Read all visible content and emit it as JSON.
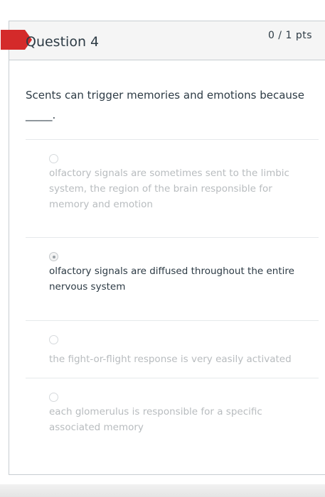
{
  "question": {
    "title": "Question 4",
    "points": "0 / 1 pts",
    "text": "Scents can trigger memories and emotions because _____.",
    "flag_color": "#d42a2a"
  },
  "answers": [
    {
      "text": "olfactory signals are sometimes sent to the limbic system, the region of the brain responsible for memory and emotion",
      "selected": false
    },
    {
      "text": "olfactory signals are diffused throughout the entire nervous system",
      "selected": true
    },
    {
      "text": "the fight-or-flight response is very easily activated",
      "selected": false
    },
    {
      "text": "each glomerulus is responsible for a specific associated memory",
      "selected": false
    }
  ]
}
